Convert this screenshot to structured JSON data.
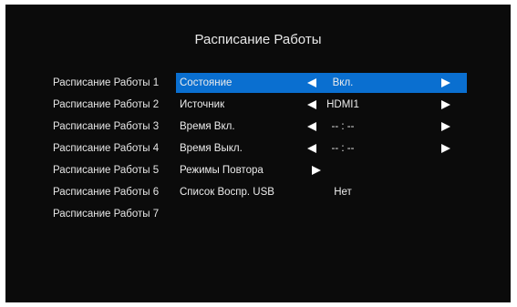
{
  "title": "Расписание Работы",
  "schedules": [
    "Расписание Работы 1",
    "Расписание Работы 2",
    "Расписание Работы 3",
    "Расписание Работы 4",
    "Расписание Работы 5",
    "Расписание Работы 6",
    "Расписание Работы 7"
  ],
  "settings": [
    {
      "label": "Состояние",
      "value": "Вкл.",
      "arrows": "both",
      "selected": true
    },
    {
      "label": "Источник",
      "value": "HDMI1",
      "arrows": "both"
    },
    {
      "label": "Время Вкл.",
      "value": "-- : --",
      "arrows": "both"
    },
    {
      "label": "Время Выкл.",
      "value": "-- : --",
      "arrows": "both"
    },
    {
      "label": "Режимы Повтора",
      "value": "",
      "arrows": "right"
    },
    {
      "label": "Список Воспр. USB",
      "value": "Нет",
      "arrows": "none"
    }
  ],
  "icons": {
    "left": "triangle-left-icon",
    "right": "triangle-right-icon"
  },
  "colors": {
    "background": "#0b0b0b",
    "highlight": "#0a6fd0",
    "text": "#ececec"
  }
}
